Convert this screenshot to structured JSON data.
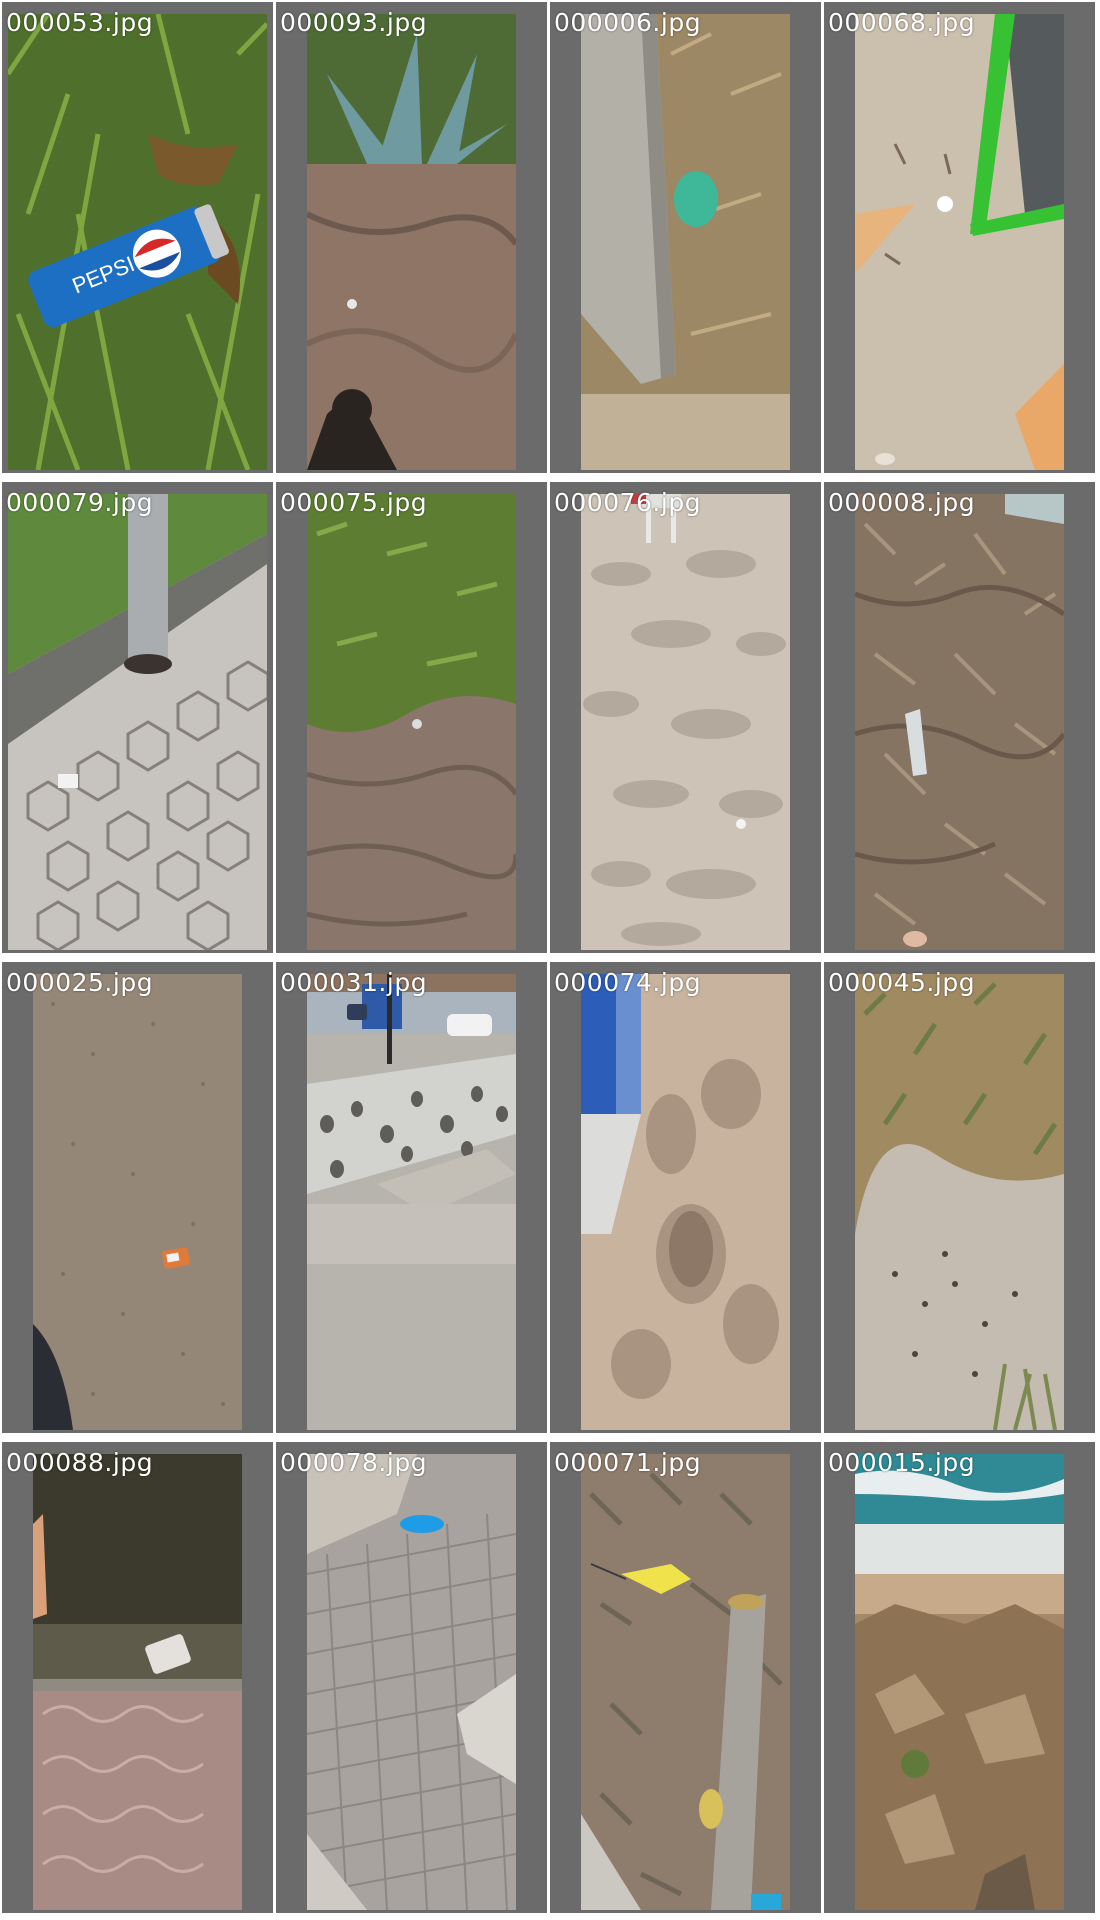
{
  "gallery": {
    "items": [
      {
        "filename": "000053.jpg",
        "scene": "grass"
      },
      {
        "filename": "000093.jpg",
        "scene": "dry-ground"
      },
      {
        "filename": "000006.jpg",
        "scene": "dry-grass"
      },
      {
        "filename": "000068.jpg",
        "scene": "sand"
      },
      {
        "filename": "000079.jpg",
        "scene": "paving"
      },
      {
        "filename": "000075.jpg",
        "scene": "shrub"
      },
      {
        "filename": "000076.jpg",
        "scene": "sand"
      },
      {
        "filename": "000008.jpg",
        "scene": "dry-grass"
      },
      {
        "filename": "000025.jpg",
        "scene": "asphalt"
      },
      {
        "filename": "000031.jpg",
        "scene": "street"
      },
      {
        "filename": "000074.jpg",
        "scene": "sand"
      },
      {
        "filename": "000045.jpg",
        "scene": "dunes"
      },
      {
        "filename": "000088.jpg",
        "scene": "tiles"
      },
      {
        "filename": "000078.jpg",
        "scene": "cobble"
      },
      {
        "filename": "000071.jpg",
        "scene": "dry-grass"
      },
      {
        "filename": "000015.jpg",
        "scene": "coast"
      }
    ]
  },
  "colors": {
    "cell_background": "#6b6b6b",
    "page_background": "#ffffff",
    "label": "#ffffff"
  }
}
